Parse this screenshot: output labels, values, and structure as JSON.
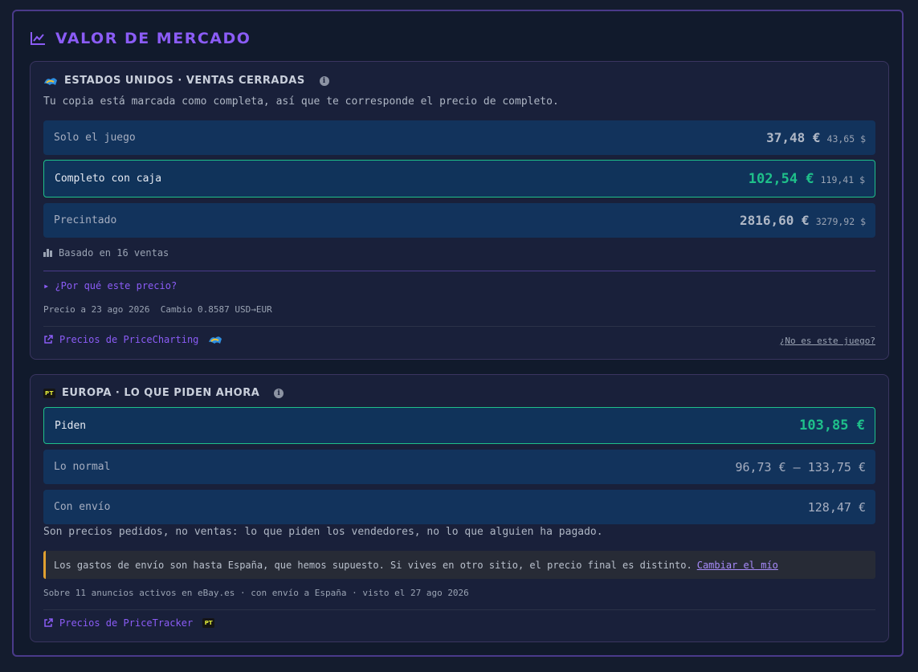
{
  "panel": {
    "title": "VALOR DE MERCADO"
  },
  "us": {
    "header": "ESTADOS UNIDOS · VENTAS CERRADAS",
    "description": "Tu copia está marcada como completa, así que te corresponde el precio de completo.",
    "rows": [
      {
        "label": "Solo el juego",
        "eur": "37,48 €",
        "usd": "43,65 $",
        "highlighted": false
      },
      {
        "label": "Completo con caja",
        "eur": "102,54 €",
        "usd": "119,41 $",
        "highlighted": true
      },
      {
        "label": "Precintado",
        "eur": "2816,60 €",
        "usd": "3279,92 $",
        "highlighted": false
      }
    ],
    "based_on": "Basado en 16 ventas",
    "why": "▸ ¿Por qué este precio?",
    "price_date": "Precio a 23 ago 2026",
    "exchange": "Cambio 0.8587 USD→EUR",
    "source_link": "Precios de PriceCharting",
    "not_this_game": "¿No es este juego?"
  },
  "eu": {
    "header": "EUROPA · LO QUE PIDEN AHORA",
    "rows": [
      {
        "label": "Piden",
        "value": "103,85 €",
        "highlighted": true
      },
      {
        "label": "Lo normal",
        "value": "96,73 € – 133,75 €",
        "highlighted": false
      },
      {
        "label": "Con envío",
        "value": "128,47 €",
        "highlighted": false
      }
    ],
    "note": "Son precios pedidos, no ventas: lo que piden los vendedores, no lo que alguien ha pagado.",
    "notice_text": "Los gastos de envío son hasta España, que hemos supuesto. Si vives en otro sitio, el precio final es distinto.",
    "notice_link": "Cambiar el mío",
    "meta": "Sobre 11 anuncios activos en eBay.es · con envío a España · visto el 27 ago 2026",
    "source_link": "Precios de PriceTracker",
    "logo_text": "PT"
  },
  "colors": {
    "accent": "#8b5cf6",
    "highlight": "#1fc08a",
    "warning": "#e0a030"
  },
  "icons": [
    "chart-line-icon",
    "pricecharting-logo",
    "info-icon",
    "bar-chart-icon",
    "external-link-icon",
    "pricetracker-logo"
  ]
}
